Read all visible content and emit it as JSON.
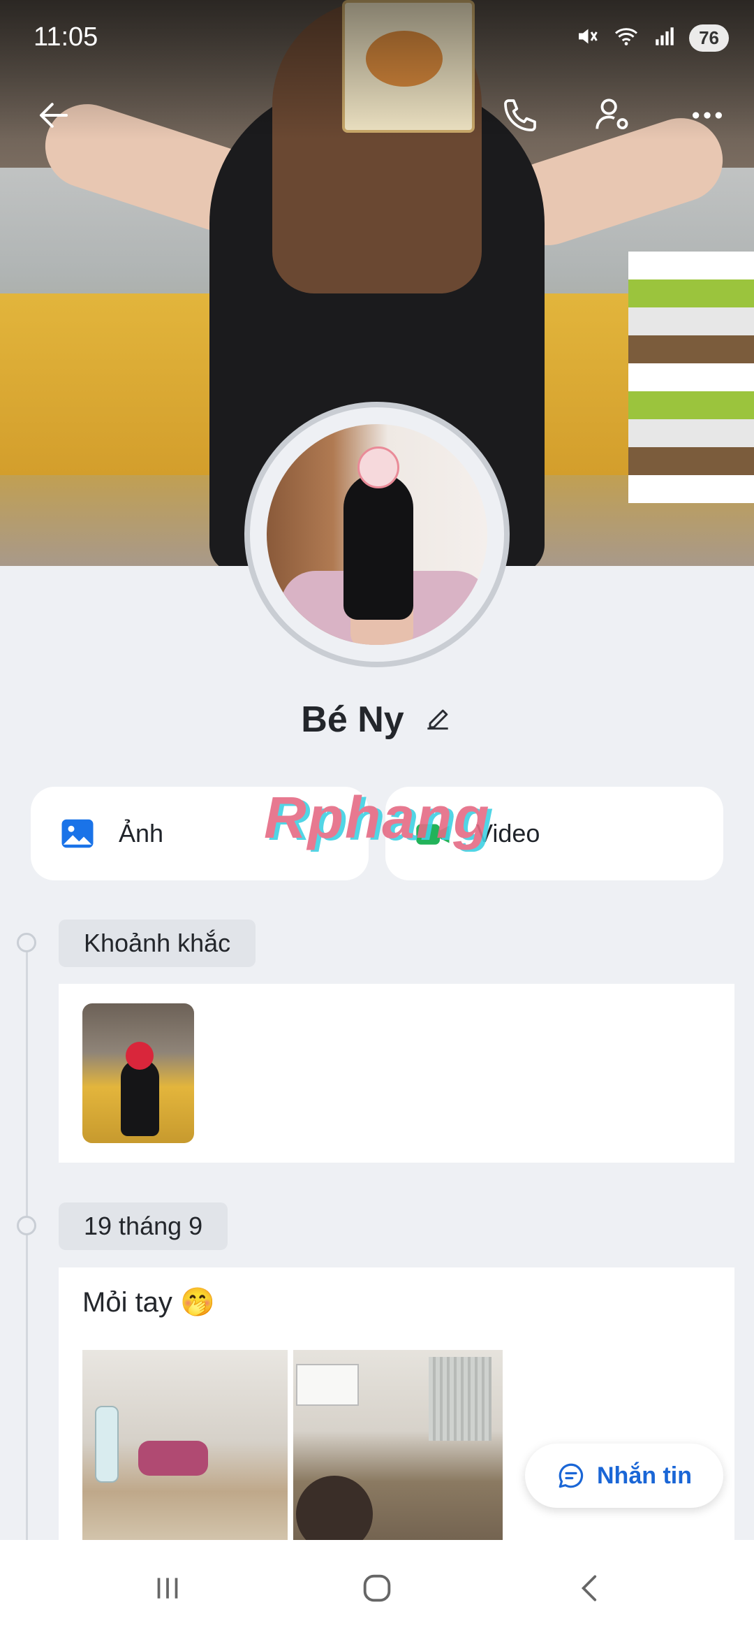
{
  "status_bar": {
    "time": "11:05",
    "battery": "76"
  },
  "profile": {
    "name": "Bé Ny"
  },
  "media": {
    "photo_label": "Ảnh",
    "video_label": "Video"
  },
  "watermark": "Rphang",
  "timeline": {
    "moments_label": "Khoảnh khắc",
    "date_label": "19 tháng 9",
    "post_text": "Mỏi tay 🤭"
  },
  "message_button": "Nhắn tin",
  "colors": {
    "accent": "#1a66d6",
    "background": "#eef0f4"
  }
}
